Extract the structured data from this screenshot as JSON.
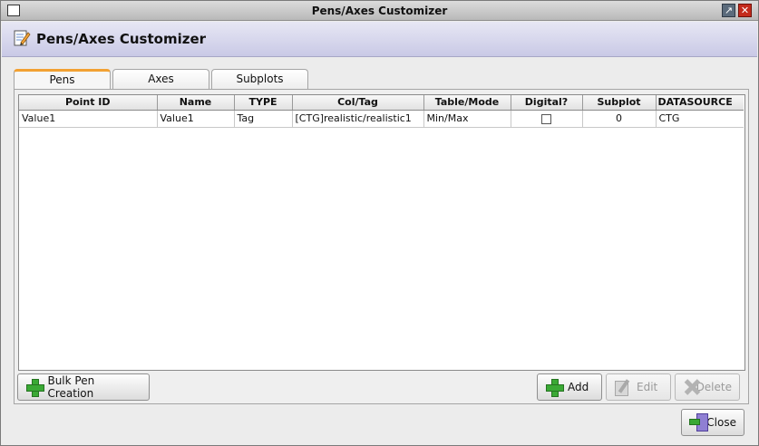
{
  "window": {
    "title": "Pens/Axes Customizer",
    "controls": {
      "restore_icon": "restore-icon",
      "close_icon": "close-icon"
    }
  },
  "header": {
    "title": "Pens/Axes Customizer",
    "icon": "edit-note-icon"
  },
  "tabs": [
    {
      "label": "Pens",
      "active": true
    },
    {
      "label": "Axes",
      "active": false
    },
    {
      "label": "Subplots",
      "active": false
    }
  ],
  "table": {
    "columns": [
      "Point ID",
      "Name",
      "TYPE",
      "Col/Tag",
      "Table/Mode",
      "Digital?",
      "Subplot",
      "DATASOURCE"
    ],
    "rows": [
      {
        "point_id": "Value1",
        "name": "Value1",
        "type": "Tag",
        "col_tag": "[CTG]realistic/realistic1",
        "table_mode": "Min/Max",
        "digital": false,
        "subplot": "0",
        "datasource": "CTG"
      }
    ]
  },
  "buttons": {
    "bulk_pen_creation": "Bulk Pen Creation",
    "add": "Add",
    "edit": "Edit",
    "delete": "Delete",
    "close": "Close"
  },
  "colors": {
    "active_tab_accent": "#f2a132",
    "header_gradient_start": "#e7e7f4",
    "header_gradient_end": "#c9c9e6",
    "add_icon_green": "#3aa935"
  }
}
